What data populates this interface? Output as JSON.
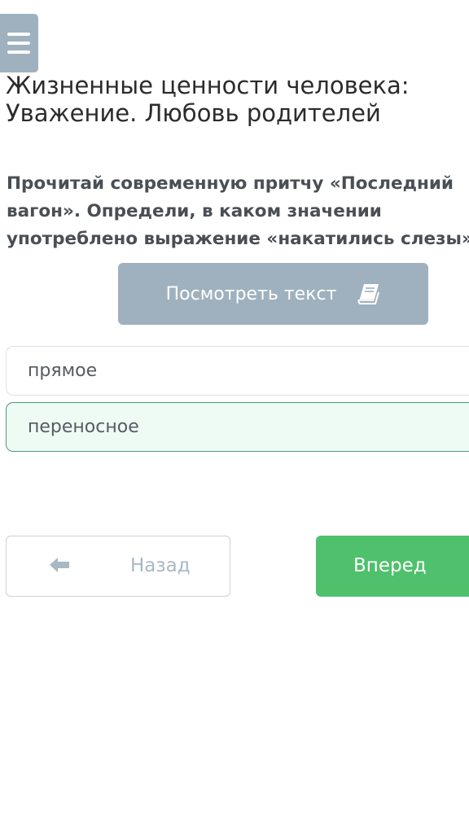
{
  "header": {
    "title_line1": "Жизненные ценности человека:",
    "title_line2": "Уважение. Любовь родителей"
  },
  "question": {
    "line1": "Прочитай современную притчу «Последний",
    "line2": "вагон». Определи, в каком значении",
    "line3": "употреблено выражение «накатились слезы»."
  },
  "view_text_button": {
    "label": "Посмотреть текст",
    "icon": "book-icon"
  },
  "options": [
    {
      "label": "прямое",
      "selected": false
    },
    {
      "label": "переносное",
      "selected": true
    }
  ],
  "navigation": {
    "back_label": "Назад",
    "back_icon": "arrow-left-icon",
    "next_label": "Вперед"
  },
  "menu": {
    "icon": "hamburger-menu-icon"
  },
  "colors": {
    "accent_gray": "#9fb1be",
    "selected_border": "#4c9a82",
    "selected_background": "#eefaf4",
    "next_green": "#4fc06c"
  }
}
